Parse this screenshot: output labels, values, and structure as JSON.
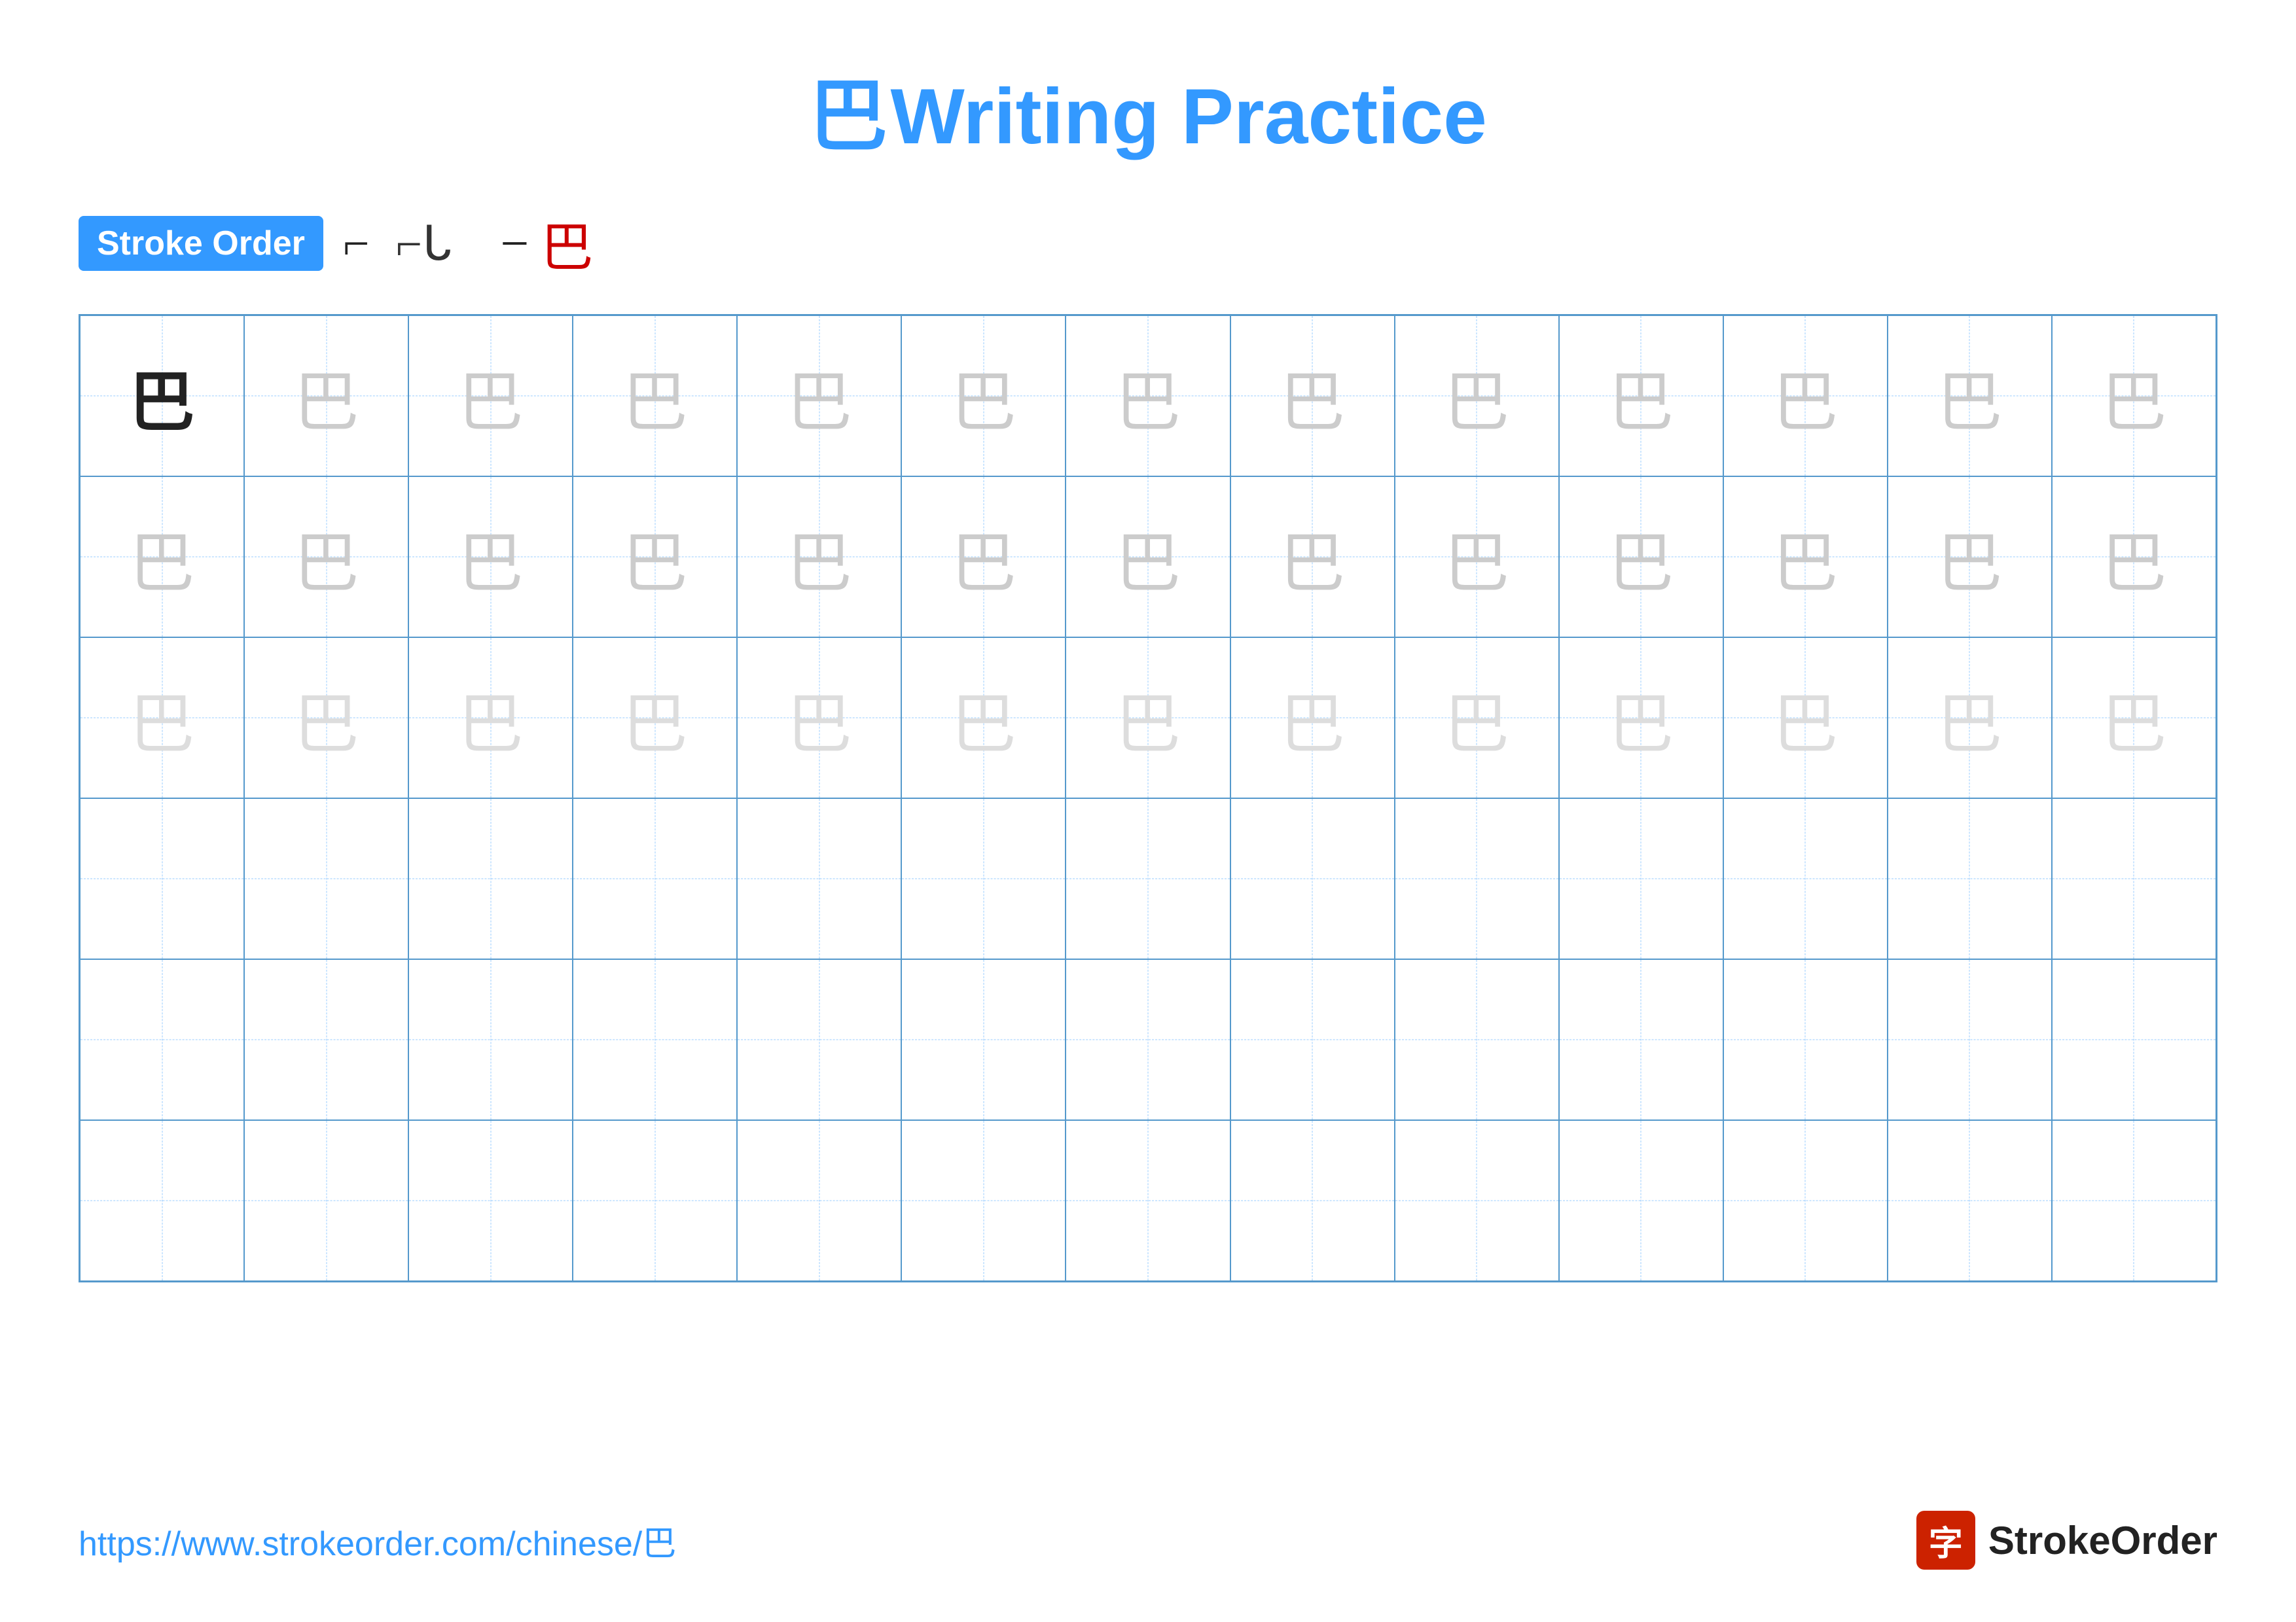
{
  "title": {
    "char": "巴",
    "text": "Writing Practice"
  },
  "stroke_order": {
    "badge_label": "Stroke Order",
    "steps": [
      "⌐",
      "⌐ᒐ",
      "⌐ᒐ⌐",
      "巴"
    ],
    "step_labels": [
      "stroke1",
      "stroke2",
      "stroke3",
      "stroke4_final"
    ]
  },
  "grid": {
    "rows": 6,
    "cols": 13,
    "char": "巴",
    "faded_rows": 3,
    "empty_rows": 3
  },
  "footer": {
    "url": "https://www.strokeorder.com/chinese/巴",
    "brand_char": "字",
    "brand_name": "StrokeOrder"
  }
}
